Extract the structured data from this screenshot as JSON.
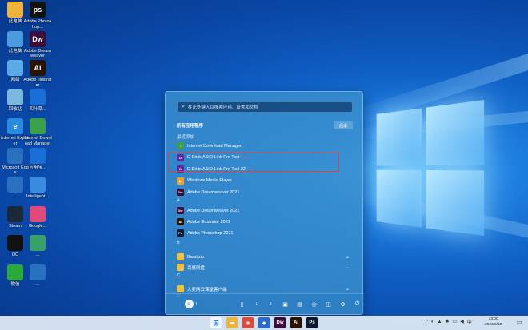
{
  "desktop": {
    "icons": [
      {
        "label": "此电脑",
        "icon": "folder-icon",
        "color": "#f0b43c"
      },
      {
        "label": "Adobe Photoshop...",
        "icon": "photoshop-icon",
        "color": "#111111",
        "glyph": "ps"
      },
      {
        "label": "此电脑",
        "icon": "computer-icon",
        "color": "#4a9be0"
      },
      {
        "label": "Adobe Dreamweaver",
        "icon": "dreamweaver-icon",
        "color": "#3a0d3a",
        "glyph": "Dw"
      },
      {
        "label": "网络",
        "icon": "network-icon",
        "color": "#5aaae8"
      },
      {
        "label": "Adobe Illustrator",
        "icon": "illustrator-icon",
        "color": "#2a1400",
        "glyph": "Ai"
      },
      {
        "label": "回收站",
        "icon": "recycle-bin-icon",
        "color": "#7ab8e0"
      },
      {
        "label": "四叶草...",
        "icon": "app-icon",
        "color": "#1a6fd6"
      },
      {
        "label": "Internet Explorer",
        "icon": "ie-icon",
        "color": "#2a8ae0",
        "glyph": "e"
      },
      {
        "label": "Internet Download Manager",
        "icon": "idm-icon",
        "color": "#3aa04a"
      },
      {
        "label": "Microsoft Edge",
        "icon": "tool-icon",
        "color": "#2a70c0"
      },
      {
        "label": "应用宝...",
        "icon": "app-icon",
        "color": "#1a6fd6"
      },
      {
        "label": "...",
        "icon": "tool-icon",
        "color": "#2a70c0"
      },
      {
        "label": "Intelligent...",
        "icon": "gear-icon",
        "color": "#3a8ae0"
      },
      {
        "label": "Steam",
        "icon": "steam-icon",
        "color": "#1b2838"
      },
      {
        "label": "Google...",
        "icon": "app-icon",
        "color": "#e04a7a"
      },
      {
        "label": "QQ",
        "icon": "qq-icon",
        "color": "#111111"
      },
      {
        "label": "...",
        "icon": "app-icon",
        "color": "#3aa06a"
      },
      {
        "label": "微信",
        "icon": "wechat-icon",
        "color": "#2aaa3a"
      },
      {
        "label": "...",
        "icon": "app-icon",
        "color": "#2a70c0"
      }
    ]
  },
  "start_menu": {
    "search_placeholder": "在此处键入以搜索应用、设置和文档",
    "section_title": "所有应用程序",
    "back_label": "后退",
    "recent_header": "最近添加",
    "apps": [
      {
        "label": "Internet Download Manager",
        "icon": "idm-icon",
        "color": "#3aa04a",
        "glyph": "↓"
      },
      {
        "label": "D Dinis ASIO Link Pro Tool",
        "icon": "asio-icon",
        "color": "#5a2aa0",
        "glyph": "D",
        "tag": "32"
      },
      {
        "label": "D Dinis ASIO Link Pro Tool 32",
        "icon": "asio-icon",
        "color": "#5a2aa0",
        "glyph": "D",
        "tag": "32"
      },
      {
        "label": "Windows Media Player",
        "icon": "media-player-icon",
        "color": "#f0a030",
        "glyph": "▶"
      },
      {
        "label": "Adobe Dreamweaver 2021",
        "icon": "dreamweaver-icon",
        "color": "#3a0d3a",
        "glyph": "Dw"
      }
    ],
    "letter_a": "A",
    "a_apps": [
      {
        "label": "Adobe Dreamweaver 2021",
        "icon": "dreamweaver-icon",
        "color": "#3a0d3a",
        "glyph": "Dw"
      },
      {
        "label": "Adobe Illustrator 2021",
        "icon": "illustrator-icon",
        "color": "#2a1400",
        "glyph": "Ai"
      },
      {
        "label": "Adobe Photoshop 2021",
        "icon": "photoshop-icon",
        "color": "#0a1a30",
        "glyph": "Ps"
      }
    ],
    "letter_b": "B",
    "b_apps": [
      {
        "label": "Bandizip",
        "icon": "folder-icon",
        "color": "#f0c040"
      },
      {
        "label": "百度网盘",
        "icon": "folder-icon",
        "color": "#f0c040"
      }
    ],
    "letter_c": "C",
    "c_apps": [
      {
        "label": "大麦网云课堂客户端",
        "icon": "folder-icon",
        "color": "#f0c040"
      }
    ],
    "letter_d": "D",
    "user_name": "I",
    "footer_icons": [
      "document-icon",
      "download-icon",
      "music-icon",
      "pictures-icon",
      "video-icon",
      "network-icon",
      "personal-folder-icon",
      "settings-icon",
      "power-icon"
    ]
  },
  "taskbar": {
    "apps": [
      {
        "icon": "start-icon",
        "glyph": "⊞"
      },
      {
        "icon": "file-explorer-icon",
        "glyph": "▬",
        "color": "#f0b43c"
      },
      {
        "icon": "chrome-icon",
        "glyph": "◉",
        "color": "#e04a3a"
      },
      {
        "icon": "shield-icon",
        "glyph": "◆",
        "color": "#2a6ad0"
      },
      {
        "icon": "dreamweaver-icon",
        "glyph": "Dw",
        "color": "#3a0d3a"
      },
      {
        "icon": "illustrator-icon",
        "glyph": "Ai",
        "color": "#2a1400"
      },
      {
        "icon": "photoshop-icon",
        "glyph": "Ps",
        "color": "#0a1a30"
      }
    ],
    "tray_icons": [
      "^",
      "◐",
      "▲",
      "✱",
      "▭",
      "◀",
      "中"
    ],
    "time": "13:00",
    "date": "2023/6/18"
  }
}
